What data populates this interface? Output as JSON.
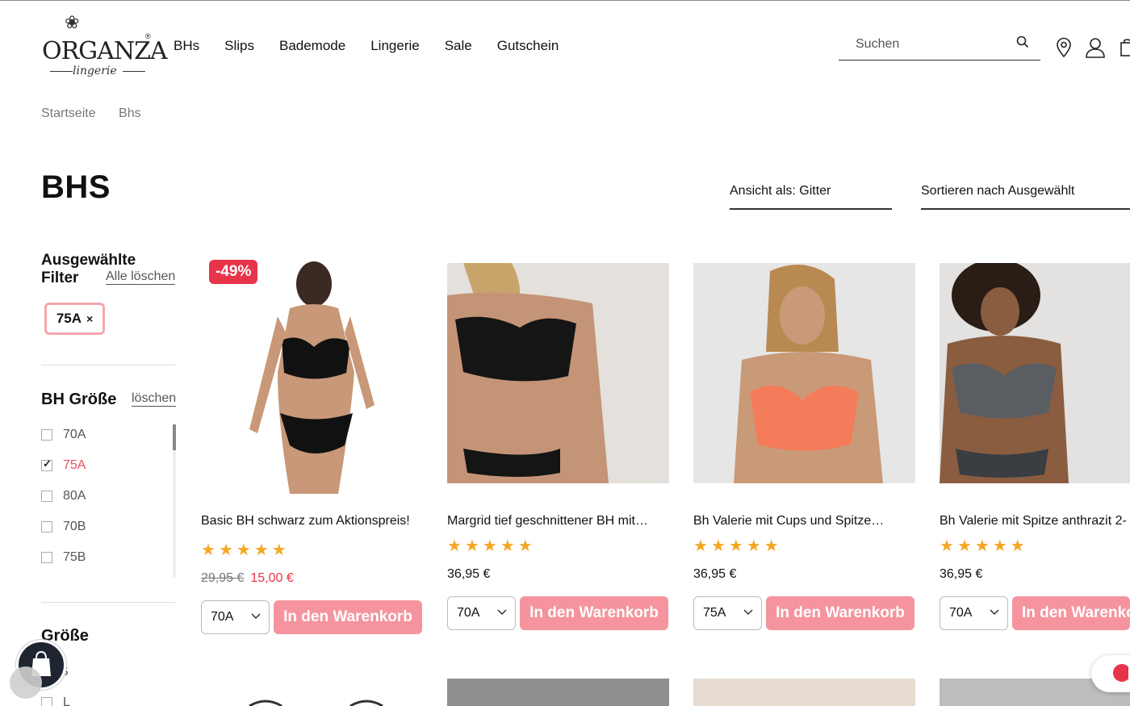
{
  "brand": {
    "name": "ORGANZA",
    "tagline": "lingerie",
    "reg": "®"
  },
  "nav": {
    "items": [
      "BHs",
      "Slips",
      "Bademode",
      "Lingerie",
      "Sale",
      "Gutschein"
    ]
  },
  "search": {
    "placeholder": "Suchen"
  },
  "breadcrumb": [
    "Startseite",
    "Bhs"
  ],
  "page": {
    "title": "BHS"
  },
  "toolbar": {
    "view": "Ansicht als: Gitter",
    "sort": "Sortieren nach Ausgewählt"
  },
  "sidebar": {
    "selected_title": "Ausgewählte Filter",
    "clear_all": "Alle löschen",
    "chip": {
      "label": "75A",
      "remove": "×"
    },
    "bh_size": {
      "title": "BH Größe",
      "clear": "löschen",
      "options": [
        {
          "label": "70A",
          "checked": false
        },
        {
          "label": "75A",
          "checked": true
        },
        {
          "label": "80A",
          "checked": false
        },
        {
          "label": "70B",
          "checked": false
        },
        {
          "label": "75B",
          "checked": false
        }
      ]
    },
    "size": {
      "title": "Größe",
      "options": [
        "S",
        "L"
      ]
    }
  },
  "products": [
    {
      "name": "Basic BH schwarz zum Aktionspreis!",
      "badge": "-49%",
      "rating": 5,
      "old_price": "29,95 €",
      "price": "15,00 €",
      "size": "70A",
      "cta": "In den Warenkorb"
    },
    {
      "name": "Margrid tief geschnittener BH mit…",
      "rating": 5,
      "price": "36,95 €",
      "size": "70A",
      "cta": "In den Warenkorb"
    },
    {
      "name": "Bh Valerie mit Cups und Spitze…",
      "rating": 5,
      "price": "36,95 €",
      "size": "75A",
      "cta": "In den Warenkorb"
    },
    {
      "name": "Bh Valerie mit Spitze anthrazit 2-",
      "rating": 5,
      "price": "36,95 €",
      "size": "70A",
      "cta": "In den Warenko"
    }
  ],
  "colors": {
    "accent": "#e8344a",
    "cart_button": "#f5949e",
    "chip_border": "#f4a7ae",
    "star": "#f5a623"
  }
}
